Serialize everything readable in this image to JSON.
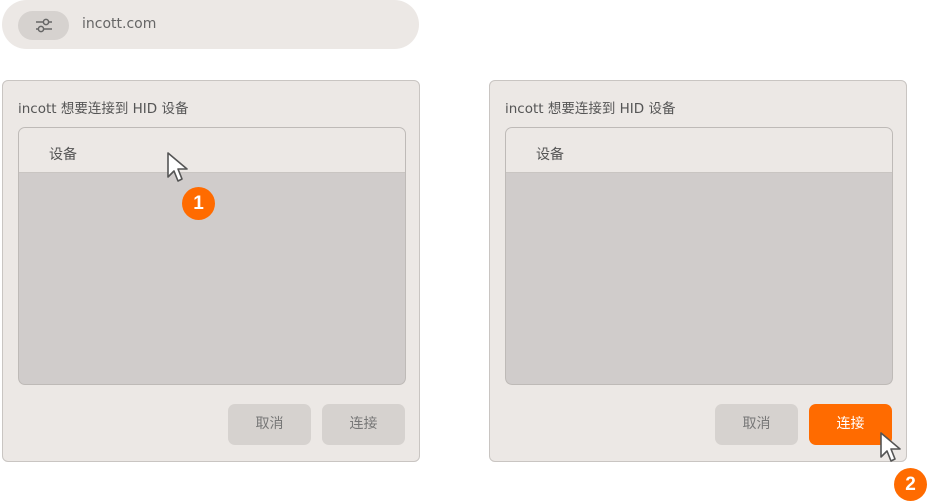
{
  "urlbar": {
    "url": "incott.com",
    "icon": "site-settings-icon"
  },
  "dialogs": [
    {
      "title": "incott 想要连接到 HID 设备",
      "list_header": "设备",
      "cancel_label": "取消",
      "connect_label": "连接",
      "connect_enabled": false
    },
    {
      "title": "incott 想要连接到 HID 设备",
      "list_header": "设备",
      "cancel_label": "取消",
      "connect_label": "连接",
      "connect_enabled": true
    }
  ],
  "steps": [
    "1",
    "2"
  ],
  "colors": {
    "accent": "#ff6b00",
    "dialog_bg": "#ece8e5",
    "list_bg": "#d0cccb",
    "button_disabled": "#d6d2cf"
  }
}
